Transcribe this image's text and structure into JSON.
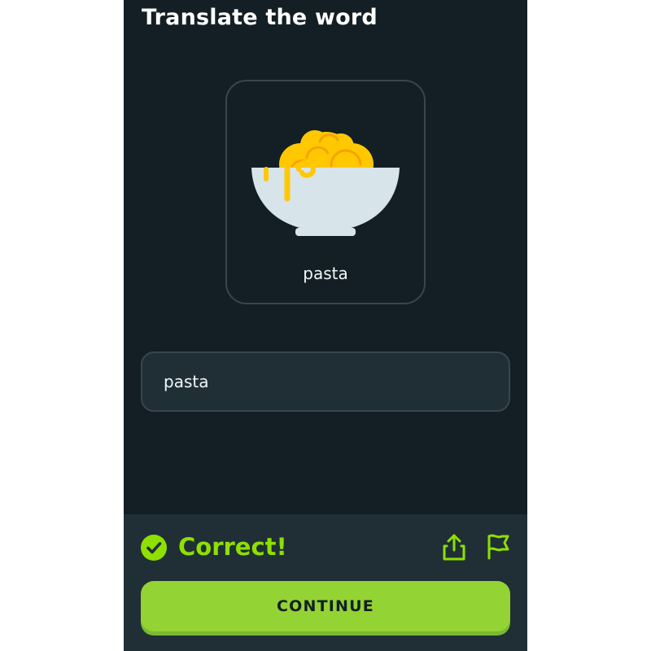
{
  "header": {
    "title": "Translate the word"
  },
  "card": {
    "icon": "pasta-bowl-icon",
    "label": "pasta"
  },
  "answer": {
    "value": "pasta",
    "placeholder": ""
  },
  "feedback": {
    "status_icon": "check-circle-icon",
    "status_text": "Correct!",
    "share_icon": "share-icon",
    "report_icon": "flag-icon",
    "continue_label": "CONTINUE"
  },
  "colors": {
    "background": "#131f24",
    "panel": "#202f36",
    "border": "#37464f",
    "accent_green": "#8ee000",
    "button_green": "#93d333",
    "pasta_yellow": "#ffc800",
    "bowl": "#d7e4ea"
  }
}
